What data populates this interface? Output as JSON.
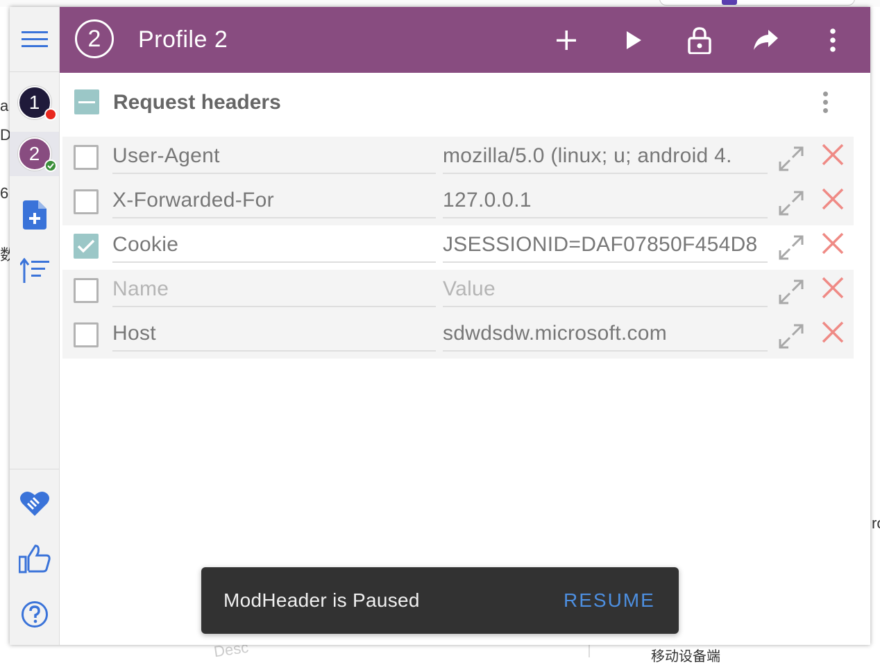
{
  "colors": {
    "brand": "#884c80",
    "accent_blue": "#3a73d9",
    "checkbox_teal": "#9bc7c7",
    "delete_red": "#ef8a85",
    "profile1": "#1f1a3a",
    "profile2": "#884c80",
    "dot_red": "#e8281e",
    "dot_green": "#3b8f3b",
    "snackbar_bg": "#323232",
    "snackbar_action": "#4d8fe0"
  },
  "background": {
    "fragments": [
      "a /",
      "DE",
      "6",
      "数",
      "ro",
      "Desc",
      "移动设备端"
    ]
  },
  "sidebar": {
    "menu_icon": "hamburger-menu-icon",
    "profiles": [
      {
        "number": "1",
        "status": "paused"
      },
      {
        "number": "2",
        "status": "active"
      }
    ],
    "actions": [
      {
        "icon": "add-file-icon",
        "label": "Add profile"
      },
      {
        "icon": "sort-icon",
        "label": "Sort"
      }
    ],
    "bottom": [
      {
        "icon": "heart-handshake-icon"
      },
      {
        "icon": "thumbs-up-icon"
      },
      {
        "icon": "help-circle-icon"
      }
    ]
  },
  "topbar": {
    "profile_number": "2",
    "title": "Profile 2",
    "buttons": [
      "add-icon",
      "play-icon",
      "lock-icon",
      "share-icon",
      "more-vertical-icon"
    ]
  },
  "section": {
    "title": "Request headers"
  },
  "headers": [
    {
      "checked": false,
      "name": "User-Agent",
      "value": "mozilla/5.0 (linux; u; android 4.",
      "name_placeholder": "Name",
      "value_placeholder": "Value"
    },
    {
      "checked": false,
      "name": "X-Forwarded-For",
      "value": "127.0.0.1",
      "name_placeholder": "Name",
      "value_placeholder": "Value"
    },
    {
      "checked": true,
      "name": "Cookie",
      "value": "JSESSIONID=DAF07850F454D8",
      "name_placeholder": "Name",
      "value_placeholder": "Value"
    },
    {
      "checked": false,
      "name": "",
      "value": "",
      "name_placeholder": "Name",
      "value_placeholder": "Value"
    },
    {
      "checked": false,
      "name": "Host",
      "value": "sdwdsdw.microsoft.com",
      "name_placeholder": "Name",
      "value_placeholder": "Value"
    }
  ],
  "snackbar": {
    "message": "ModHeader is Paused",
    "action": "RESUME"
  }
}
